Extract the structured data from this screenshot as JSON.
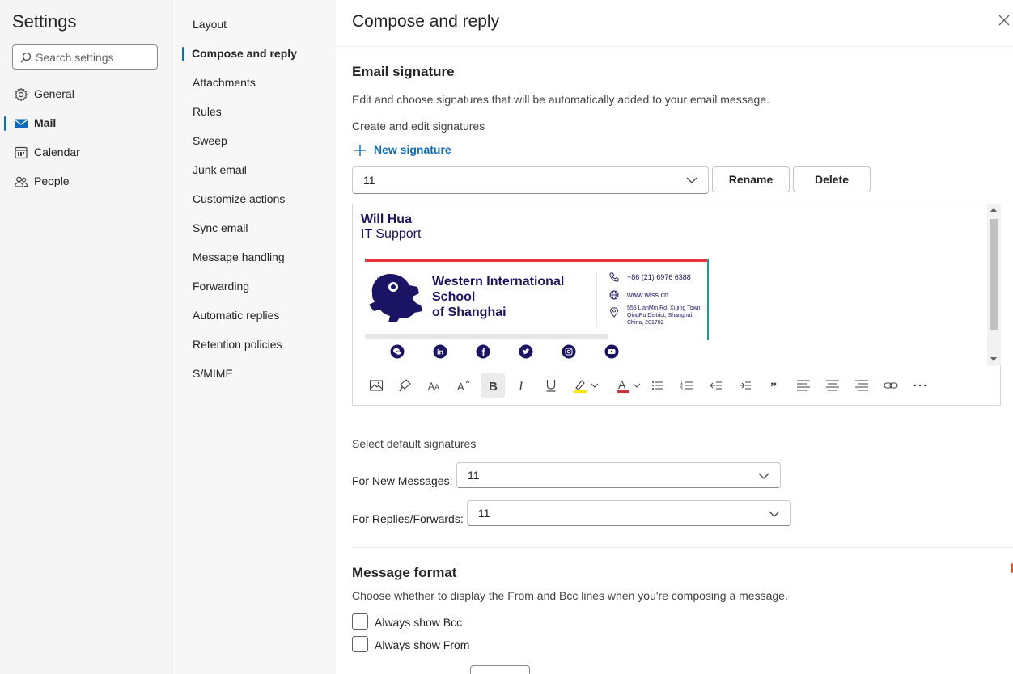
{
  "settings": {
    "title": "Settings",
    "search_placeholder": "Search settings",
    "categories": [
      {
        "label": "General",
        "icon": "gear-icon"
      },
      {
        "label": "Mail",
        "icon": "mail-icon",
        "active": true
      },
      {
        "label": "Calendar",
        "icon": "calendar-icon"
      },
      {
        "label": "People",
        "icon": "people-icon"
      }
    ]
  },
  "mail_nav": {
    "items": [
      {
        "label": "Layout"
      },
      {
        "label": "Compose and reply",
        "active": true
      },
      {
        "label": "Attachments"
      },
      {
        "label": "Rules"
      },
      {
        "label": "Sweep"
      },
      {
        "label": "Junk email"
      },
      {
        "label": "Customize actions"
      },
      {
        "label": "Sync email"
      },
      {
        "label": "Message handling"
      },
      {
        "label": "Forwarding"
      },
      {
        "label": "Automatic replies"
      },
      {
        "label": "Retention policies"
      },
      {
        "label": "S/MIME"
      }
    ]
  },
  "page": {
    "title": "Compose and reply",
    "email_signature": {
      "heading": "Email signature",
      "description": "Edit and choose signatures that will be automatically added to your email message.",
      "create_label": "Create and edit signatures",
      "new_signature": "New signature",
      "selected_signature": "11",
      "rename": "Rename",
      "delete": "Delete",
      "signature": {
        "name": "Will Hua",
        "role": "IT Support",
        "school_line1": "Western International",
        "school_line2": "School",
        "school_line3": "of Shanghai",
        "phone": "+86 (21) 6976 6388",
        "website": "www.wiss.cn",
        "address_line1": "555 LianMin Rd, Xujing Town,",
        "address_line2": "QingPu District, Shanghai,",
        "address_line3": "China, 201702",
        "social_icons": [
          "wechat-icon",
          "linkedin-icon",
          "facebook-icon",
          "twitter-icon",
          "instagram-icon",
          "youtube-icon"
        ],
        "colors": {
          "navy": "#1b1464",
          "red": "#e8343c",
          "teal": "#16a085"
        }
      },
      "toolbar": [
        "insert-image",
        "format-painter",
        "font-size",
        "grow-font",
        "bold",
        "italic",
        "underline",
        "highlight",
        "font-color",
        "bullets",
        "numbering",
        "decrease-indent",
        "increase-indent",
        "quote",
        "align-left",
        "align-center",
        "align-right",
        "link",
        "more"
      ]
    },
    "default_signatures": {
      "heading": "Select default signatures",
      "new_messages_label": "For New Messages:",
      "new_messages_value": "11",
      "replies_label": "For Replies/Forwards:",
      "replies_value": "11"
    },
    "message_format": {
      "heading": "Message format",
      "description": "Choose whether to display the From and Bcc lines when you're composing a message.",
      "show_bcc": "Always show Bcc",
      "show_bcc_checked": false,
      "show_from": "Always show From",
      "show_from_checked": false
    }
  },
  "colors": {
    "accent": "#0f6cbd"
  }
}
